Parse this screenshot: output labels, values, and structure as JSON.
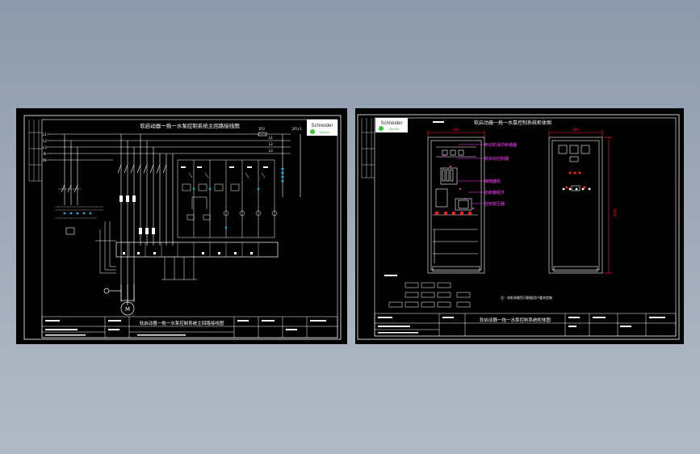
{
  "left_sheet": {
    "title": "软启动器一拖一水泵控制系统主回路接线图",
    "title_block_title": "软启动器一拖一水泵控制系统主回路接线图",
    "labels": {
      "L1": "L1",
      "L2": "L2",
      "L3": "L3",
      "N": "N",
      "PE": "PE",
      "tfu": "1FU",
      "tfu1": "2FU-1",
      "r_L1": "L1",
      "r_L2": "L2",
      "r_L3": "L3",
      "motor": "M"
    },
    "logo": {
      "line1": "Schneider",
      "line2": "Electric"
    }
  },
  "right_sheet": {
    "title": "软启动器一拖一水泵控制系统柜体图",
    "title_block_title": "软启动器一拖一水泵控制系统柜体图",
    "components": [
      "电动机保护断路器",
      "软启动控制器",
      "接触器组",
      "熔断器组件",
      "控制变压器"
    ],
    "dim_width": "600",
    "dim_height": "2000",
    "note": "注：本柜体颜色可根据用户要求定制",
    "logo": {
      "line1": "Schneider",
      "line2": "Electric"
    }
  },
  "colors": {
    "line": "#ffffff",
    "red": "#ff2020",
    "green": "#3cc23c",
    "yellow": "#ffd400",
    "cyan": "#00c8ff",
    "magenta": "#ff40ff"
  }
}
